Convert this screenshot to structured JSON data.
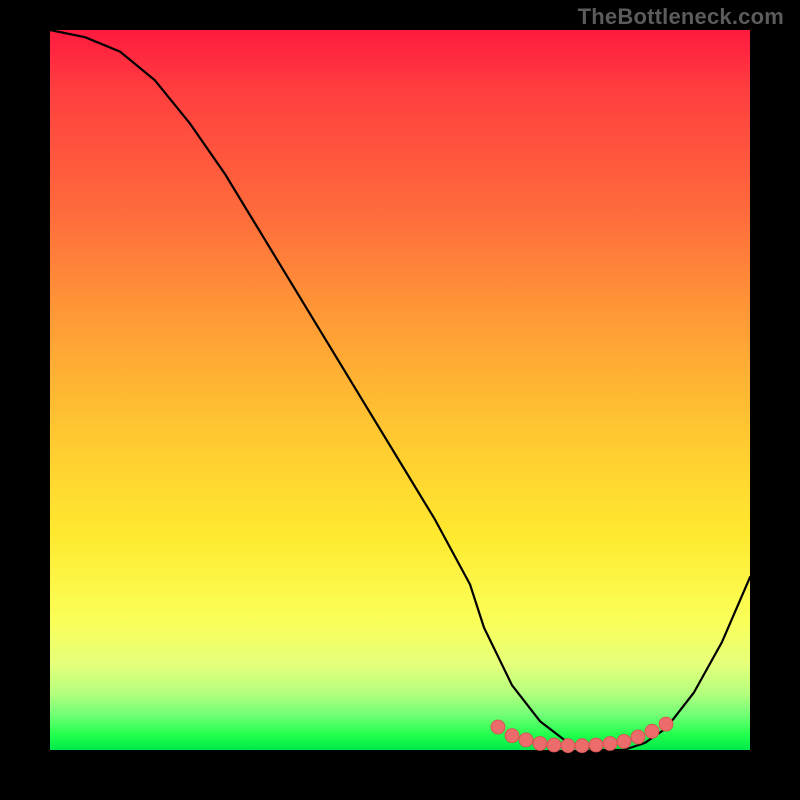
{
  "watermark": "TheBottleneck.com",
  "chart_data": {
    "type": "line",
    "title": "",
    "xlabel": "",
    "ylabel": "",
    "xlim": [
      0,
      100
    ],
    "ylim": [
      0,
      100
    ],
    "grid": false,
    "legend": false,
    "annotations": [],
    "series": [
      {
        "name": "curve",
        "x": [
          0,
          5,
          10,
          15,
          20,
          25,
          30,
          35,
          40,
          45,
          50,
          55,
          60,
          62,
          66,
          70,
          74,
          78,
          82,
          85,
          88,
          92,
          96,
          100
        ],
        "y": [
          100,
          99,
          97,
          93,
          87,
          80,
          72,
          64,
          56,
          48,
          40,
          32,
          23,
          17,
          9,
          4,
          1,
          0,
          0,
          1,
          3,
          8,
          15,
          24
        ],
        "color": "#000000"
      }
    ],
    "markers": {
      "name": "bottom-cluster",
      "x": [
        64,
        66,
        68,
        70,
        72,
        74,
        76,
        78,
        80,
        82,
        84,
        86,
        88
      ],
      "y": [
        3.2,
        2.0,
        1.4,
        0.9,
        0.7,
        0.6,
        0.6,
        0.7,
        0.9,
        1.2,
        1.8,
        2.6,
        3.6
      ],
      "color": "#ec6b6b",
      "size": 7
    },
    "background_gradient": {
      "orientation": "vertical",
      "stops": [
        {
          "pos": 0.0,
          "color": "#ff1a3f"
        },
        {
          "pos": 0.25,
          "color": "#ff6a3c"
        },
        {
          "pos": 0.55,
          "color": "#ffc531"
        },
        {
          "pos": 0.82,
          "color": "#faff58"
        },
        {
          "pos": 0.95,
          "color": "#74ff77"
        },
        {
          "pos": 1.0,
          "color": "#00e84a"
        }
      ]
    }
  }
}
